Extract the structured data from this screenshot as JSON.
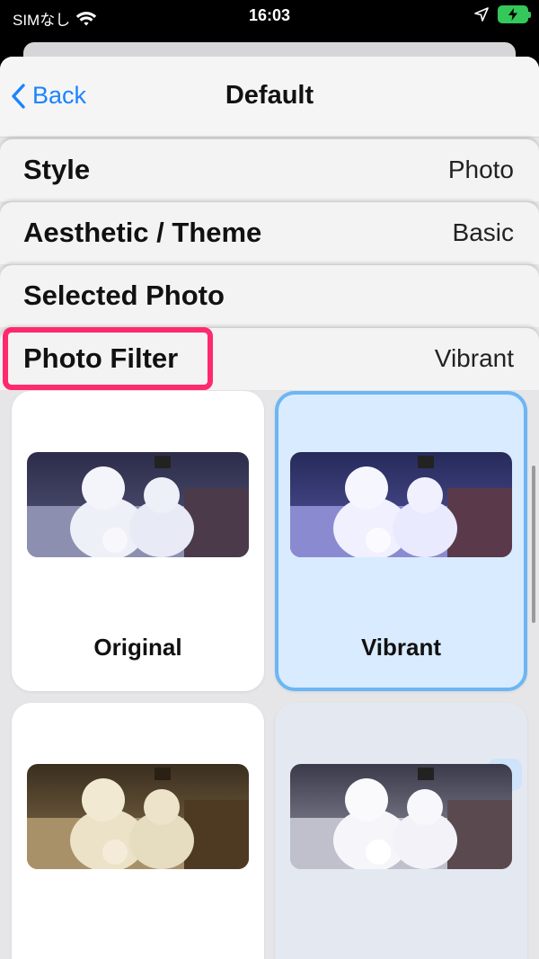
{
  "status_bar": {
    "carrier": "SIMなし",
    "time": "16:03"
  },
  "nav": {
    "back_label": "Back",
    "title": "Default"
  },
  "settings": [
    {
      "label": "Style",
      "value": "Photo"
    },
    {
      "label": "Aesthetic / Theme",
      "value": "Basic"
    },
    {
      "label": "Selected Photo",
      "value": ""
    },
    {
      "label": "Photo Filter",
      "value": "Vibrant"
    }
  ],
  "filters": [
    {
      "label": "Original",
      "selected": false,
      "locked": false
    },
    {
      "label": "Vibrant",
      "selected": true,
      "locked": false
    },
    {
      "label": "",
      "selected": false,
      "locked": false
    },
    {
      "label": "",
      "selected": false,
      "locked": true
    }
  ],
  "colors": {
    "accent": "#1a84ff",
    "highlight": "#ff2a6d",
    "selected_border": "#6cb6f5",
    "battery": "#34c759"
  },
  "icons": [
    "wifi-icon",
    "location-arrow-icon",
    "battery-charging-icon",
    "chevron-left-icon",
    "lock-icon"
  ]
}
